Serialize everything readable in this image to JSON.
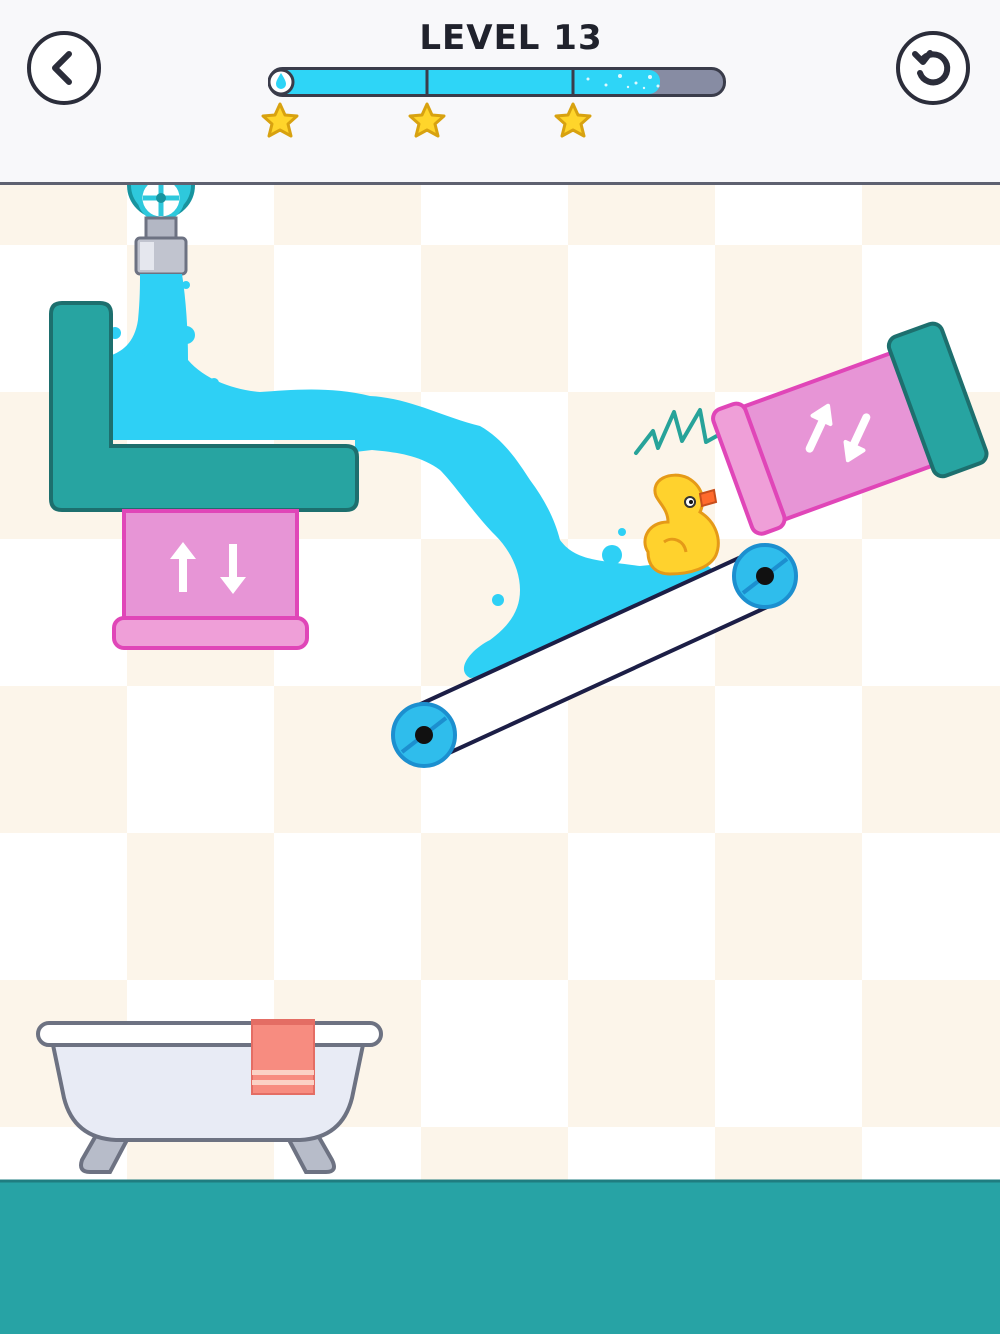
{
  "header": {
    "level_title": "LEVEL 13",
    "back_icon": "chevron-left-icon",
    "restart_icon": "restart-icon",
    "progress_fraction": 0.86,
    "stars": 3
  },
  "colors": {
    "water": "#2ed0f5",
    "teal": "#27a4a1",
    "pink": "#e795d6",
    "pink_border": "#e046b8",
    "tile": "#fcf5ea",
    "floor": "#27a3a5",
    "star": "#ffd52b"
  },
  "scene": {
    "block_left_arrows": "up-down-arrows-icon",
    "block_right_arrows": "diagonal-arrows-icon"
  }
}
